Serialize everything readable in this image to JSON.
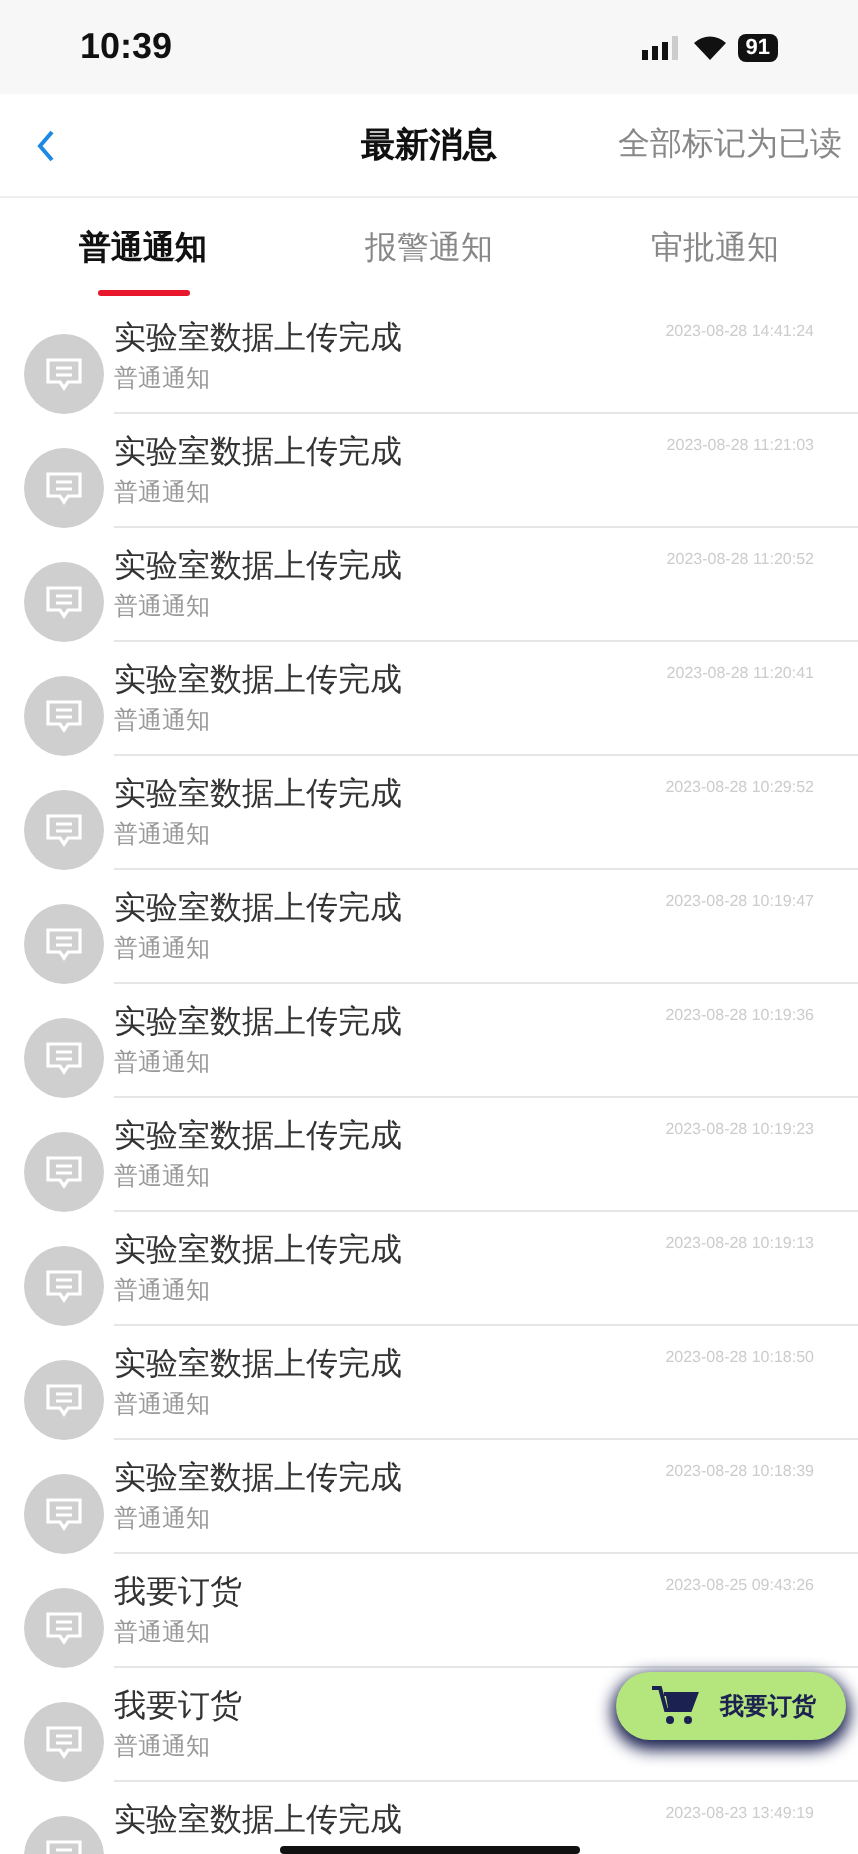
{
  "status_bar": {
    "time": "10:39",
    "battery": "91"
  },
  "nav": {
    "title": "最新消息",
    "action": "全部标记为已读"
  },
  "tabs": [
    {
      "label": "普通通知",
      "selected": true
    },
    {
      "label": "报警通知",
      "selected": false
    },
    {
      "label": "审批通知",
      "selected": false
    }
  ],
  "messages": [
    {
      "title": "实验室数据上传完成",
      "type": "普通通知",
      "time": "2023-08-28 14:41:24"
    },
    {
      "title": "实验室数据上传完成",
      "type": "普通通知",
      "time": "2023-08-28 11:21:03"
    },
    {
      "title": "实验室数据上传完成",
      "type": "普通通知",
      "time": "2023-08-28 11:20:52"
    },
    {
      "title": "实验室数据上传完成",
      "type": "普通通知",
      "time": "2023-08-28 11:20:41"
    },
    {
      "title": "实验室数据上传完成",
      "type": "普通通知",
      "time": "2023-08-28 10:29:52"
    },
    {
      "title": "实验室数据上传完成",
      "type": "普通通知",
      "time": "2023-08-28 10:19:47"
    },
    {
      "title": "实验室数据上传完成",
      "type": "普通通知",
      "time": "2023-08-28 10:19:36"
    },
    {
      "title": "实验室数据上传完成",
      "type": "普通通知",
      "time": "2023-08-28 10:19:23"
    },
    {
      "title": "实验室数据上传完成",
      "type": "普通通知",
      "time": "2023-08-28 10:19:13"
    },
    {
      "title": "实验室数据上传完成",
      "type": "普通通知",
      "time": "2023-08-28 10:18:50"
    },
    {
      "title": "实验室数据上传完成",
      "type": "普通通知",
      "time": "2023-08-28 10:18:39"
    },
    {
      "title": "我要订货",
      "type": "普通通知",
      "time": "2023-08-25 09:43:26"
    },
    {
      "title": "我要订货",
      "type": "普通通知"
    },
    {
      "title": "实验室数据上传完成",
      "time": "2023-08-23 13:49:19"
    }
  ],
  "order_button": {
    "label": "我要订货"
  }
}
